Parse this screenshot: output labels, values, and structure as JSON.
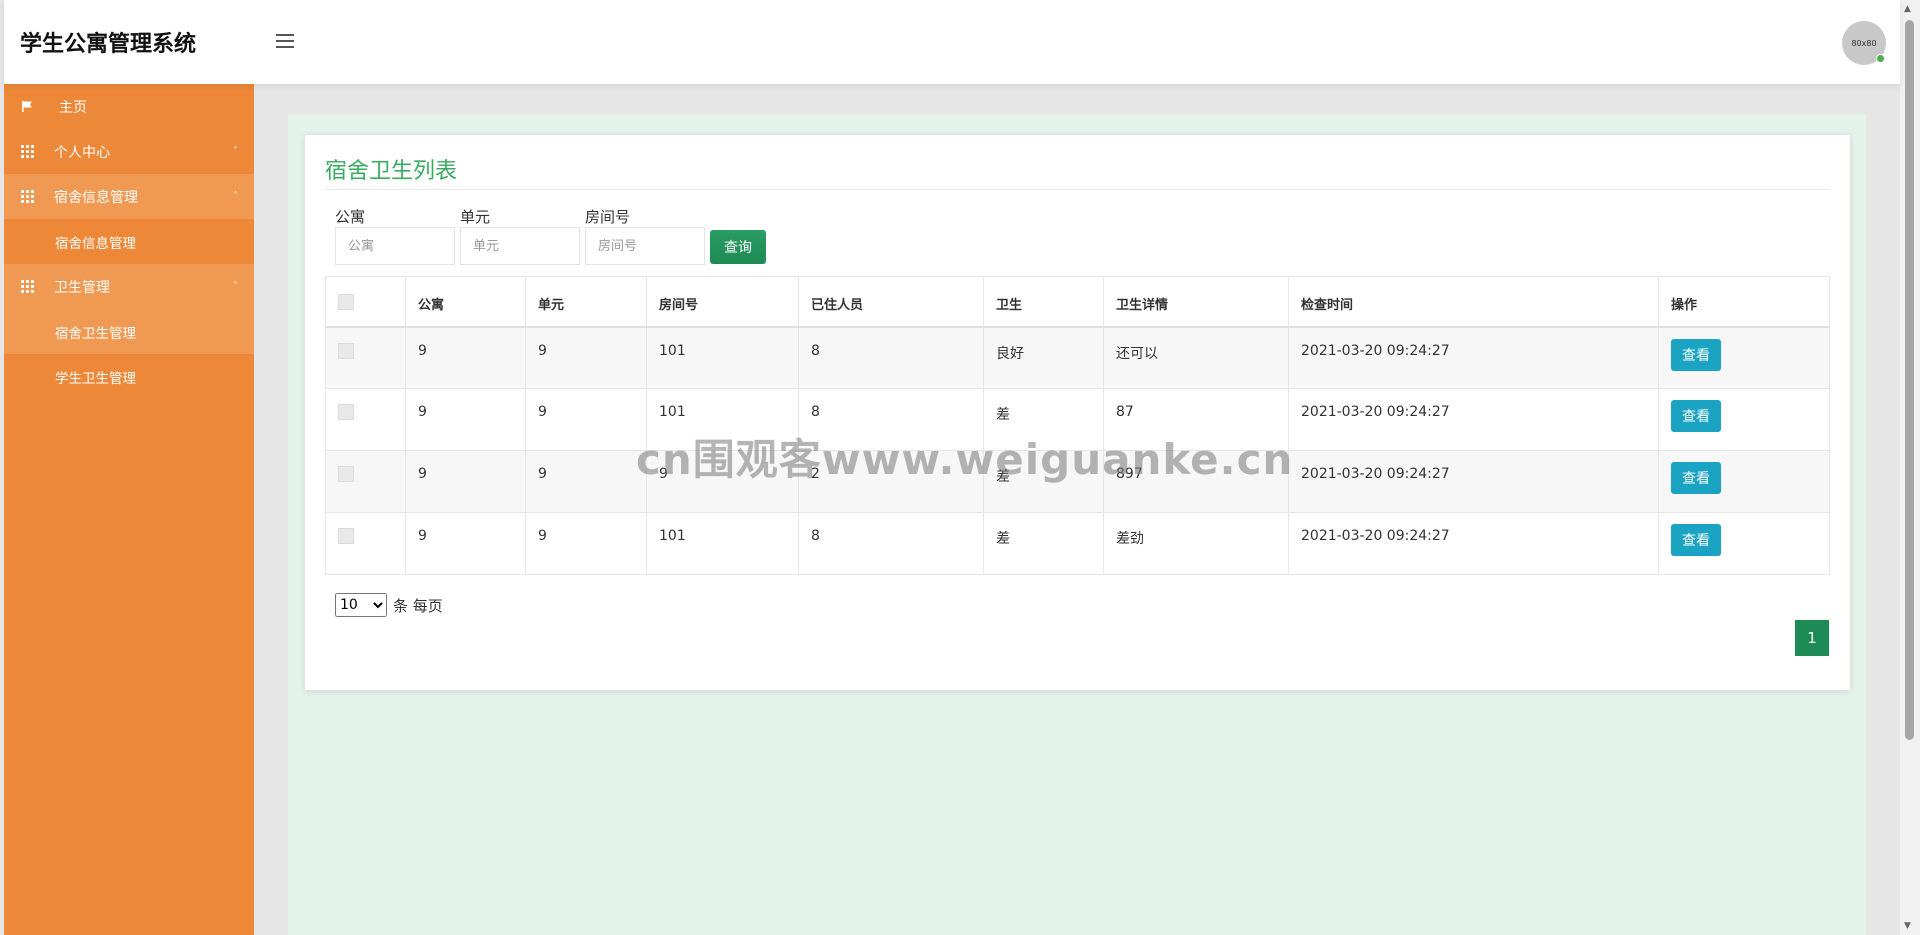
{
  "header": {
    "title": "学生公寓管理系统",
    "avatar_text": "80x80"
  },
  "sidebar": {
    "items": [
      {
        "label": "主页",
        "icon": "flag-icon"
      },
      {
        "label": "个人中心",
        "icon": "grid-icon",
        "caret": "˅"
      },
      {
        "label": "宿舍信息管理",
        "icon": "grid-icon",
        "caret": "˄",
        "children": [
          "宿舍信息管理"
        ]
      },
      {
        "label": "卫生管理",
        "icon": "grid-icon",
        "caret": "˄",
        "children": [
          "宿舍卫生管理",
          "学生卫生管理"
        ]
      }
    ]
  },
  "panel": {
    "title": "宿舍卫生列表",
    "filters": [
      {
        "label": "公寓",
        "placeholder": "公寓"
      },
      {
        "label": "单元",
        "placeholder": "单元"
      },
      {
        "label": "房间号",
        "placeholder": "房间号"
      }
    ],
    "search_label": "查询"
  },
  "table": {
    "headers": [
      "",
      "公寓",
      "单元",
      "房间号",
      "已住人员",
      "卫生",
      "卫生详情",
      "检查时间",
      "操作"
    ],
    "rows": [
      [
        "9",
        "9",
        "101",
        "8",
        "良好",
        "还可以",
        "2021-03-20 09:24:27"
      ],
      [
        "9",
        "9",
        "101",
        "8",
        "差",
        "87",
        "2021-03-20 09:24:27"
      ],
      [
        "9",
        "9",
        "9",
        "2",
        "差",
        "897",
        "2021-03-20 09:24:27"
      ],
      [
        "9",
        "9",
        "101",
        "8",
        "差",
        "差劲",
        "2021-03-20 09:24:27"
      ]
    ],
    "view_label": "查看"
  },
  "pagination": {
    "per_page_value": "10",
    "per_page_suffix": "条 每页",
    "current_page": "1"
  },
  "watermark": "cn围观客www.weiguanke.cn",
  "colors": {
    "sidebar": "#ec8838",
    "accent_green": "#3aab62",
    "button_green": "#1e8a55",
    "view_button": "#1aa3c3"
  }
}
